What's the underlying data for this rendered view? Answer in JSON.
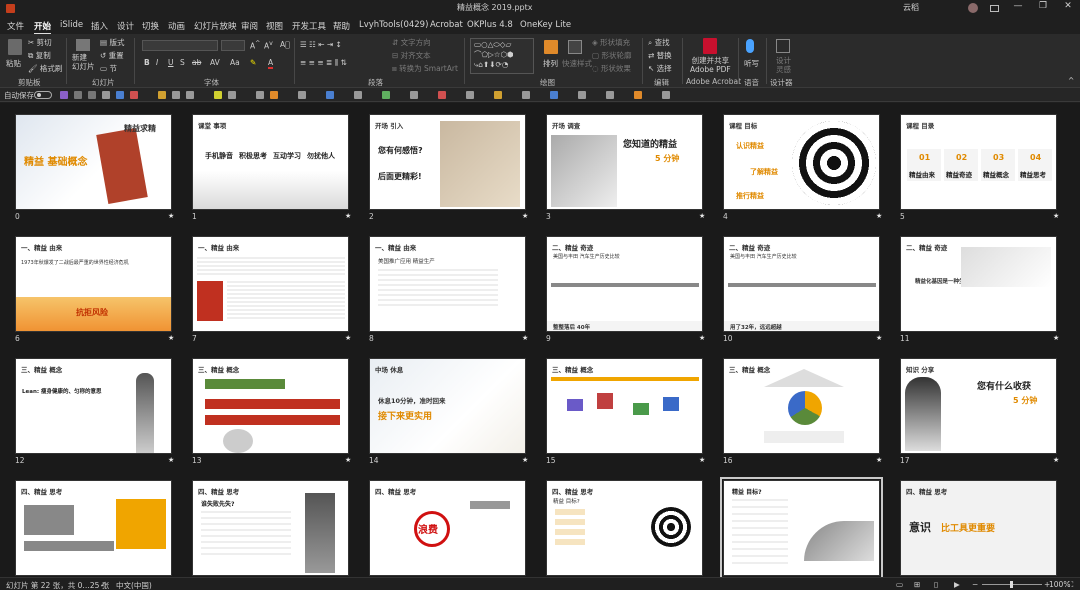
{
  "window": {
    "title": "精益概念 2019.pptx",
    "user": "云稻",
    "minimize": "—",
    "restore": "❐",
    "close": "✕"
  },
  "menu": [
    "文件",
    "开始",
    "iSlide",
    "插入",
    "设计",
    "切换",
    "动画",
    "幻灯片放映",
    "审阅",
    "视图",
    "开发工具",
    "帮助",
    "LvyhTools(0429)",
    "Acrobat",
    "OKPlus 4.8",
    "OneKey Lite"
  ],
  "active_tab": "开始",
  "share_label": "共享",
  "ribbon": {
    "clipboard": {
      "paste": "粘贴",
      "cut": "剪切",
      "copy": "复制",
      "format_painter": "格式刷",
      "group": "剪贴板"
    },
    "slides": {
      "new_slide": "新建\n幻灯片",
      "layout": "版式",
      "reset": "重置",
      "section": "节",
      "group": "幻灯片"
    },
    "font": {
      "group": "字体",
      "bold": "B",
      "italic": "I",
      "underline": "U",
      "strike": "S",
      "shadow": "ab",
      "spacing": "AV",
      "case": "Aa",
      "color": "A"
    },
    "paragraph": {
      "text_direction": "文字方向",
      "align_text": "对齐文本",
      "smartart": "转换为 SmartArt",
      "group": "段落"
    },
    "drawing": {
      "arrange": "排列",
      "quick_styles": "快速样式",
      "shape_fill": "形状填充",
      "shape_outline": "形状轮廓",
      "shape_effects": "形状效果",
      "group": "绘图"
    },
    "editing": {
      "find": "查找",
      "replace": "替换",
      "select": "选择",
      "group": "编辑"
    },
    "acrobat": {
      "create": "创建并共享\nAdobe PDF",
      "group": "Adobe Acrobat"
    },
    "voice": {
      "dictate": "听写",
      "group": "语音"
    },
    "designer": {
      "ideas": "设计\n灵感",
      "group": "设计器"
    }
  },
  "qat": {
    "autosave": "自动保存",
    "autosave_state": "关"
  },
  "slides": [
    {
      "num": "0",
      "section": "",
      "title": "精益 基础概念",
      "sub": "精益求精"
    },
    {
      "num": "1",
      "section": "课堂 事项",
      "items": [
        "手机静音",
        "积极思考",
        "互动学习",
        "勿扰他人"
      ]
    },
    {
      "num": "2",
      "section": "开场 引入",
      "lines": [
        "您有何感悟?",
        "后面更精彩!"
      ]
    },
    {
      "num": "3",
      "section": "开场 调查",
      "title": "您知道的精益",
      "timer": "5 分钟"
    },
    {
      "num": "4",
      "section": "课程 目标",
      "labels": [
        "认识精益",
        "了解精益",
        "推行精益"
      ]
    },
    {
      "num": "5",
      "section": "课程 目录",
      "items": [
        {
          "n": "01",
          "t": "精益由来"
        },
        {
          "n": "02",
          "t": "精益奇迹"
        },
        {
          "n": "03",
          "t": "精益概念"
        },
        {
          "n": "04",
          "t": "精益思考"
        }
      ]
    },
    {
      "num": "6",
      "section": "一、精益 由来",
      "body": "1973年秋爆发了二战后最严重的世界性经济危机",
      "highlight": "抗拒风险"
    },
    {
      "num": "7",
      "section": "一、精益 由来",
      "body": ""
    },
    {
      "num": "8",
      "section": "一、精益 由来",
      "body": "美国推广应用 精益生产"
    },
    {
      "num": "9",
      "section": "二、精益 奇迹",
      "body": "美国与丰田 汽车生产历史比较",
      "foot": "整整落后 40年"
    },
    {
      "num": "10",
      "section": "二、精益 奇迹",
      "body": "美国与丰田 汽车生产历史比较",
      "foot": "用了32年，远远超越"
    },
    {
      "num": "11",
      "section": "二、精益 奇迹",
      "body": "精益化基因是一种生产方式"
    },
    {
      "num": "12",
      "section": "三、精益 概念",
      "body": "Lean: 瘦身健康的、匀称的意思"
    },
    {
      "num": "13",
      "section": "三、精益 概念",
      "body": ""
    },
    {
      "num": "14",
      "section": "中场 休息",
      "lines": [
        "休息10分钟，准时回来",
        "接下来更实用"
      ]
    },
    {
      "num": "15",
      "section": "三、精益 概念",
      "body": ""
    },
    {
      "num": "16",
      "section": "三、精益 概念",
      "body": ""
    },
    {
      "num": "17",
      "section": "知识 分享",
      "title": "您有什么收获",
      "timer": "5 分钟"
    },
    {
      "num": "18",
      "section": "四、精益 思考",
      "body": ""
    },
    {
      "num": "19",
      "section": "四、精益 思考",
      "body": "谁失败先失?"
    },
    {
      "num": "20",
      "section": "四、精益 思考",
      "body": "浪费"
    },
    {
      "num": "21",
      "section": "四、精益 思考",
      "body": "精益 目标?"
    },
    {
      "num": "22",
      "section": "",
      "body": "精益 目标?"
    },
    {
      "num": "23",
      "section": "四、精益 思考",
      "title": "意识",
      "highlight": "比工具更重要"
    }
  ],
  "status": {
    "slide_info": "幻灯片 第 22 张，共 0…25 张",
    "language": "中文(中国)",
    "zoom": "100%"
  }
}
